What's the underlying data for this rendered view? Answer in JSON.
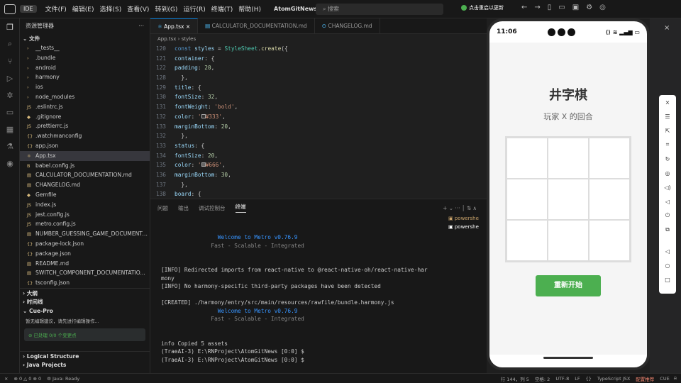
{
  "titlebar": {
    "ide": "IDE",
    "menus": [
      "文件(F)",
      "编辑(E)",
      "选择(S)",
      "查看(V)",
      "转到(G)",
      "运行(R)",
      "终端(T)",
      "帮助(H)"
    ],
    "project": "AtomGitNews",
    "search": "搜索",
    "update": "点击重启以更新"
  },
  "explorer": {
    "title": "资源管理器",
    "section": "文件",
    "items": [
      {
        "icon": "›",
        "label": "__tests__"
      },
      {
        "icon": "›",
        "label": ".bundle"
      },
      {
        "icon": "›",
        "label": "android"
      },
      {
        "icon": "›",
        "label": "harmony"
      },
      {
        "icon": "›",
        "label": "ios"
      },
      {
        "icon": "›",
        "label": "node_modules"
      },
      {
        "icon": "JS",
        "label": ".eslintrc.js"
      },
      {
        "icon": "◆",
        "label": ".gitignore"
      },
      {
        "icon": "JS",
        "label": ".prettierrc.js"
      },
      {
        "icon": "{}",
        "label": ".watchmanconfig"
      },
      {
        "icon": "{}",
        "label": "app.json"
      },
      {
        "icon": "⚛",
        "label": "App.tsx"
      },
      {
        "icon": "B",
        "label": "babel.config.js"
      },
      {
        "icon": "▤",
        "label": "CALCULATOR_DOCUMENTATION.md"
      },
      {
        "icon": "▤",
        "label": "CHANGELOG.md"
      },
      {
        "icon": "◆",
        "label": "Gemfile"
      },
      {
        "icon": "JS",
        "label": "index.js"
      },
      {
        "icon": "JS",
        "label": "jest.config.js"
      },
      {
        "icon": "JS",
        "label": "metro.config.js"
      },
      {
        "icon": "▤",
        "label": "NUMBER_GUESSING_GAME_DOCUMENTA..."
      },
      {
        "icon": "{}",
        "label": "package-lock.json"
      },
      {
        "icon": "{}",
        "label": "package.json"
      },
      {
        "icon": "▤",
        "label": "README.md"
      },
      {
        "icon": "▤",
        "label": "SWITCH_COMPONENT_DOCUMENTATIO..."
      },
      {
        "icon": "{}",
        "label": "tsconfig.json"
      }
    ],
    "outline": "大纲",
    "timeline": "时间线",
    "cue_title": "Cue-Pro",
    "cue_hint": "暂无编辑建议，请先进行编辑操作...",
    "cue_status": "已处理 0/0 个变更点",
    "structure": "Logical Structure",
    "java": "Java Projects"
  },
  "editor": {
    "tabs": [
      "App.tsx",
      "CALCULATOR_DOCUMENTATION.md",
      "CHANGELOG.md"
    ],
    "crumb1": "App.tsx",
    "crumb2": "styles"
  },
  "panel": {
    "tabs": [
      "问题",
      "输出",
      "调试控制台",
      "终端"
    ],
    "terminals": [
      "powershe",
      "powershe"
    ],
    "lines": [
      {
        "c": "blue",
        "t": "                 Welcome to Metro v0.76.9"
      },
      {
        "c": "gray",
        "t": "               Fast - Scalable - Integrated"
      },
      {
        "c": "",
        "t": ""
      },
      {
        "c": "",
        "t": ""
      },
      {
        "c": "",
        "t": "[INFO] Redirected imports from react-native to @react-native-oh/react-native-har"
      },
      {
        "c": "",
        "t": "mony"
      },
      {
        "c": "",
        "t": "[INFO] No harmony-specific third-party packages have been detected"
      },
      {
        "c": "",
        "t": ""
      },
      {
        "c": "",
        "t": "[CREATED] ./harmony/entry/src/main/resources/rawfile/bundle.harmony.js"
      },
      {
        "c": "blue",
        "t": "                 Welcome to Metro v0.76.9"
      },
      {
        "c": "gray",
        "t": "               Fast - Scalable - Integrated"
      },
      {
        "c": "",
        "t": ""
      },
      {
        "c": "",
        "t": ""
      },
      {
        "c": "",
        "t": "info Copied 5 assets"
      },
      {
        "c": "",
        "t": "(TraeAI-3) E:\\RNProject\\AtomGitNews [0:0] $"
      },
      {
        "c": "",
        "t": "(TraeAI-3) E:\\RNProject\\AtomGitNews [0:0] $"
      }
    ]
  },
  "phone": {
    "time": "11:06",
    "title": "井字棋",
    "status": "玩家 X 的回合",
    "reset": "重新开始"
  },
  "statusbar": {
    "errors": "0",
    "warnings": "0",
    "java": "Java: Ready",
    "pos": "行 144，列 5",
    "spaces": "空格: 2",
    "enc": "UTF-8",
    "eol": "LF",
    "lang": "TypeScript JSX",
    "cue": "CUE",
    "cfg": "配置推荐"
  }
}
